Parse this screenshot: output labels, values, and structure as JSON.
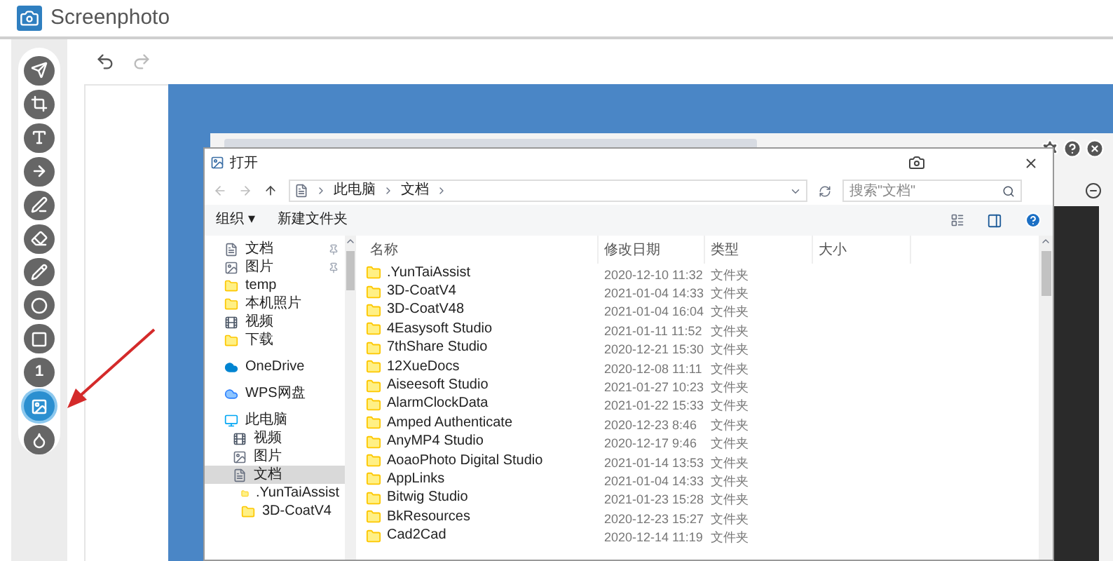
{
  "app": {
    "title": "Screenphoto"
  },
  "tools": [
    {
      "kind": "plane",
      "selected": false
    },
    {
      "kind": "crop",
      "selected": false
    },
    {
      "kind": "text",
      "selected": false
    },
    {
      "kind": "arrow",
      "selected": false
    },
    {
      "kind": "pen",
      "selected": false
    },
    {
      "kind": "eraser",
      "selected": false
    },
    {
      "kind": "pencil",
      "selected": false
    },
    {
      "kind": "circle",
      "selected": false
    },
    {
      "kind": "square",
      "selected": false
    },
    {
      "kind": "number",
      "label": "1",
      "selected": false
    },
    {
      "kind": "image",
      "selected": true
    },
    {
      "kind": "drop",
      "selected": false
    }
  ],
  "dialog": {
    "title": "打开",
    "path": [
      "此电脑",
      "文档"
    ],
    "search": {
      "placeholder": "搜索\"文档\""
    },
    "toolbar": {
      "organize": "组织 ▾",
      "new_folder": "新建文件夹"
    },
    "nav": [
      {
        "kind": "doc",
        "label": "文档",
        "pinned": true,
        "selected": false
      },
      {
        "kind": "pic",
        "label": "图片",
        "pinned": true,
        "selected": false
      },
      {
        "kind": "folder",
        "label": "temp",
        "selected": false
      },
      {
        "kind": "folder",
        "label": "本机照片",
        "selected": false
      },
      {
        "kind": "video",
        "label": "视频",
        "selected": false
      },
      {
        "kind": "folder",
        "label": "下载",
        "selected": false
      },
      {
        "kind": "cloud",
        "label": "OneDrive",
        "selected": false
      },
      {
        "kind": "wps",
        "label": "WPS网盘",
        "selected": false
      },
      {
        "kind": "pc",
        "label": "此电脑",
        "selected": false,
        "children": [
          {
            "kind": "video",
            "label": "视频",
            "selected": false
          },
          {
            "kind": "pic",
            "label": "图片",
            "selected": false
          },
          {
            "kind": "doc",
            "label": "文档",
            "selected": true,
            "children": [
              {
                "kind": "folder",
                "label": ".YunTaiAssist",
                "selected": false
              },
              {
                "kind": "folder",
                "label": "3D-CoatV4",
                "selected": false
              }
            ]
          }
        ]
      }
    ],
    "columns": [
      "名称",
      "修改日期",
      "类型",
      "大小"
    ],
    "rows": [
      [
        ".YunTaiAssist",
        "2020-12-10 11:32",
        "文件夹"
      ],
      [
        "3D-CoatV4",
        "2021-01-04 14:33",
        "文件夹"
      ],
      [
        "3D-CoatV48",
        "2021-01-04 16:04",
        "文件夹"
      ],
      [
        "4Easysoft Studio",
        "2021-01-11 11:52",
        "文件夹"
      ],
      [
        "7thShare Studio",
        "2020-12-21 15:30",
        "文件夹"
      ],
      [
        "12XueDocs",
        "2020-12-08 11:11",
        "文件夹"
      ],
      [
        "Aiseesoft Studio",
        "2021-01-27 10:23",
        "文件夹"
      ],
      [
        "AlarmClockData",
        "2021-01-22 15:33",
        "文件夹"
      ],
      [
        "Amped Authenticate",
        "2020-12-23 8:46",
        "文件夹"
      ],
      [
        "AnyMP4 Studio",
        "2020-12-17 9:46",
        "文件夹"
      ],
      [
        "AoaoPhoto Digital Studio",
        "2021-01-14 13:53",
        "文件夹"
      ],
      [
        "AppLinks",
        "2021-01-04 14:33",
        "文件夹"
      ],
      [
        "Bitwig Studio",
        "2021-01-23 15:28",
        "文件夹"
      ],
      [
        "BkResources",
        "2020-12-23 15:27",
        "文件夹"
      ],
      [
        "Cad2Cad",
        "2020-12-14 11:19",
        "文件夹"
      ]
    ]
  }
}
